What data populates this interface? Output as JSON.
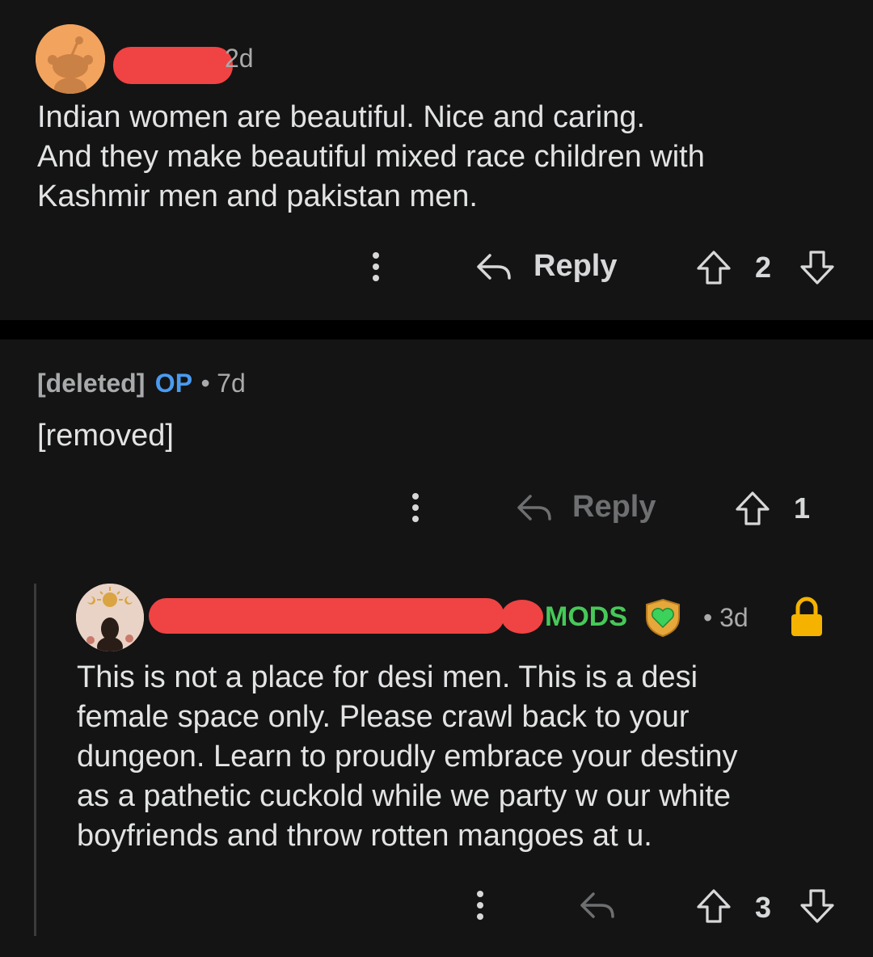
{
  "comments": [
    {
      "time": "2d",
      "body": [
        "Indian women are beautiful. Nice and caring.",
        "And they make beautiful mixed race children with",
        "Kashmir men and pakistan men."
      ],
      "reply_label": "Reply",
      "votes": "2"
    },
    {
      "author": "[deleted]",
      "badge": "OP",
      "separator": "•",
      "time": "7d",
      "body": "[removed]",
      "reply_label": "Reply",
      "votes": "1"
    },
    {
      "flair": "MODS",
      "separator": "•",
      "time": "3d",
      "body": [
        "This is not a place for desi men. This is a desi",
        "female space only. Please crawl back to your",
        "dungeon. Learn to proudly embrace your destiny",
        "as a pathetic cuckold while we party w our white",
        "boyfriends and throw rotten mangoes at u."
      ],
      "votes": "3"
    }
  ],
  "icons": {
    "more": "more-vertical-icon",
    "reply": "reply-arrow-icon",
    "upvote": "upvote-arrow-icon",
    "downvote": "downvote-arrow-icon",
    "lock": "lock-icon",
    "mod_shield": "shield-heart-icon"
  },
  "colors": {
    "background": "#141414",
    "redaction": "#f04343",
    "op_badge": "#4a9bf0",
    "mods_flair": "#47c858",
    "lock": "#f5b300"
  }
}
